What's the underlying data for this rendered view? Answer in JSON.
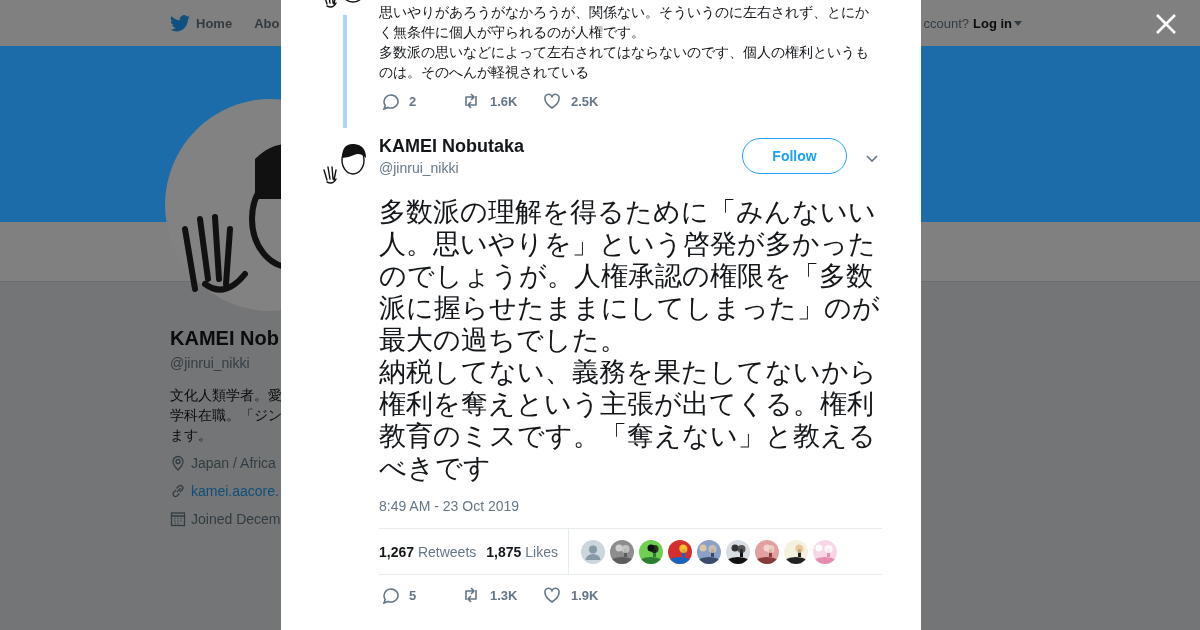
{
  "header": {
    "nav": [
      {
        "label": "Home"
      },
      {
        "label": "Abo"
      }
    ],
    "account_prompt": "ccount?",
    "login": "Log in"
  },
  "profile": {
    "name": "KAMEI Nob",
    "handle": "@jinrui_nikki",
    "bio": [
      "文化人類学者。愛",
      "学科在職。「ジン",
      "ます。"
    ],
    "location": "Japan / Africa",
    "url": "kamei.aacore.",
    "joined": "Joined Decem"
  },
  "previous_tweet": {
    "paragraphs": [
      "思いやりがあろうがなかろうが、関係ない。そういうのに左右されず、とにかく無条件に個人が守られるのが人権です。",
      "多数派の思いなどによって左右されてはならないのです、個人の権利というものは。そのへんが軽視されている"
    ],
    "actions": [
      {
        "kind": "reply",
        "count": "2"
      },
      {
        "kind": "retweet",
        "count": "1.6K"
      },
      {
        "kind": "like",
        "count": "2.5K"
      }
    ]
  },
  "tweet": {
    "name": "KAMEI Nobutaka",
    "handle": "@jinrui_nikki",
    "follow_label": "Follow",
    "paragraphs": [
      "多数派の理解を得るために「みんないい人。思いやりを」という啓発が多かったのでしょうが。人権承認の権限を「多数派に握らせたままにしてしまった」のが最大の過ちでした。",
      "納税してない、義務を果たしてないから権利を奪えという主張が出てくる。権利教育のミスです。「奪えない」と教えるべきです"
    ],
    "timestamp": "8:49 AM - 23 Oct 2019",
    "stats": [
      {
        "count": "1,267",
        "label": "Retweets"
      },
      {
        "count": "1,875",
        "label": "Likes"
      }
    ],
    "likers": [
      {
        "kind": "default"
      },
      {
        "kind": "picture"
      },
      {
        "kind": "picture"
      },
      {
        "kind": "picture"
      },
      {
        "kind": "picture"
      },
      {
        "kind": "picture"
      },
      {
        "kind": "picture"
      },
      {
        "kind": "picture"
      },
      {
        "kind": "picture"
      }
    ],
    "actions": [
      {
        "kind": "reply",
        "count": "5"
      },
      {
        "kind": "retweet",
        "count": "1.3K"
      },
      {
        "kind": "like",
        "count": "1.9K"
      }
    ]
  }
}
